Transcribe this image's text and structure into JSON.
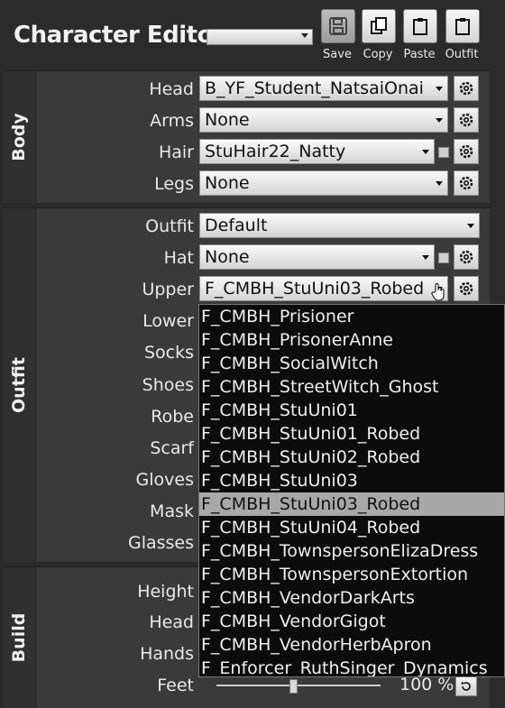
{
  "header": {
    "title": "Character Editor",
    "preset_value": "",
    "buttons": [
      {
        "label": "Save",
        "icon": "save-icon"
      },
      {
        "label": "Copy",
        "icon": "copy-icon"
      },
      {
        "label": "Paste",
        "icon": "paste-icon"
      },
      {
        "label": "Outfit",
        "icon": "outfit-icon"
      }
    ]
  },
  "body": {
    "tab": "Body",
    "rows": [
      {
        "label": "Head",
        "value": "B_YF_Student_NatsaiOnai"
      },
      {
        "label": "Arms",
        "value": "None"
      },
      {
        "label": "Hair",
        "value": "StuHair22_Natty"
      },
      {
        "label": "Legs",
        "value": "None"
      }
    ]
  },
  "outfit": {
    "tab": "Outfit",
    "rows": [
      {
        "label": "Outfit",
        "value": "Default"
      },
      {
        "label": "Hat",
        "value": "None"
      },
      {
        "label": "Upper",
        "value": "F_CMBH_StuUni03_Robed"
      },
      {
        "label": "Lower"
      },
      {
        "label": "Socks"
      },
      {
        "label": "Shoes"
      },
      {
        "label": "Robe"
      },
      {
        "label": "Scarf"
      },
      {
        "label": "Gloves"
      },
      {
        "label": "Mask"
      },
      {
        "label": "Glasses"
      }
    ]
  },
  "build": {
    "tab": "Build",
    "rows": [
      {
        "label": "Height"
      },
      {
        "label": "Head"
      },
      {
        "label": "Hands"
      },
      {
        "label": "Feet"
      }
    ],
    "feet_percent": "100 %",
    "feet_value": 0.45
  },
  "dropdown_options": [
    "F_CMBH_Prisioner",
    "F_CMBH_PrisonerAnne",
    "F_CMBH_SocialWitch",
    "F_CMBH_StreetWitch_Ghost",
    "F_CMBH_StuUni01",
    "F_CMBH_StuUni01_Robed",
    "F_CMBH_StuUni02_Robed",
    "F_CMBH_StuUni03",
    "F_CMBH_StuUni03_Robed",
    "F_CMBH_StuUni04_Robed",
    "F_CMBH_TownspersonElizaDress",
    "F_CMBH_TownspersonExtortion",
    "F_CMBH_VendorDarkArts",
    "F_CMBH_VendorGigot",
    "F_CMBH_VendorHerbApron",
    "F_Enforcer_RuthSinger_Dynamics"
  ],
  "selected_option_index": 8
}
